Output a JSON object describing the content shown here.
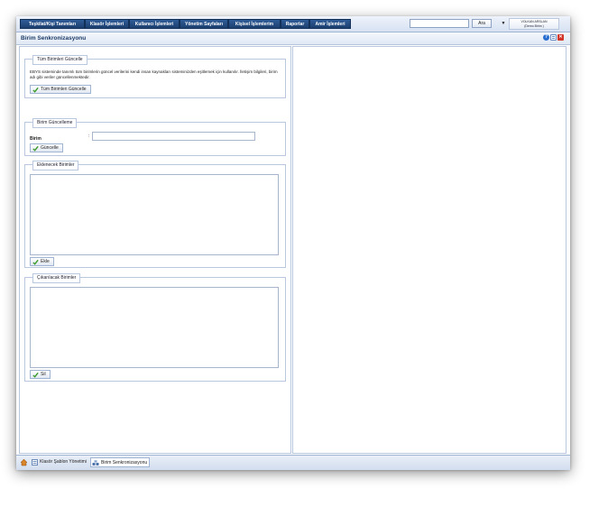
{
  "menu": {
    "items": [
      {
        "label": "Teşkilat/Kişi Tanımları"
      },
      {
        "label": "Klasör İşlemleri"
      },
      {
        "label": "Kullanıcı İşlemleri"
      },
      {
        "label": "Yönetim Sayfaları"
      },
      {
        "label": "Kişisel İşlemlerim"
      },
      {
        "label": "Raporlar"
      },
      {
        "label": "Amir İşlemleri"
      }
    ],
    "search_button": "Ara",
    "user_name": "VOLKAN ARSLAN",
    "user_subtitle": "(Demo Birim )",
    "dropdown_glyph": "▼"
  },
  "page": {
    "title": "Birim Senkronizasyonu"
  },
  "sections": {
    "all_units": {
      "legend": "Tüm Birimleri Güncelle",
      "description": "EBYS sisteminde tanımlı tüm birimlerin güncel verilerini kendi insan kaynakları sisteminizden eşitlemek için kullanılır. İletişim bilgileri, birim adı gibi veriler güncellenmektedir.",
      "button": "Tüm Birimleri Güncelle"
    },
    "unit_update": {
      "legend": "Birim Güncelleme",
      "field_label": "Birim",
      "colon": ":",
      "button": "Güncelle"
    },
    "to_add": {
      "legend": "Eklenecek Birimler",
      "button": "Ekle"
    },
    "to_remove": {
      "legend": "Çıkarılacak Birimler",
      "button": "Sil"
    }
  },
  "tabs": [
    {
      "label": "Klasör Şablon Yönetimi"
    },
    {
      "label": "Birim Senkronizasyonu"
    }
  ]
}
